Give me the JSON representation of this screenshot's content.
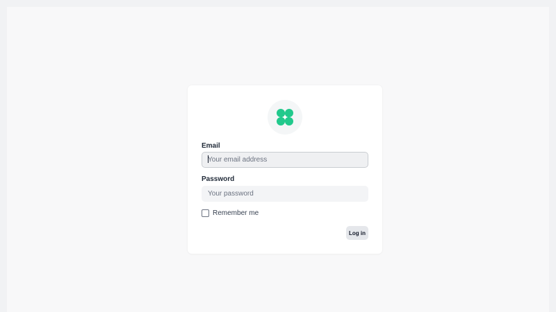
{
  "logo": {
    "name": "clover-logo-icon",
    "color": "#21c98c"
  },
  "form": {
    "email_label": "Email",
    "email_placeholder": "Your email address",
    "email_value": "",
    "password_label": "Password",
    "password_placeholder": "Your password",
    "password_value": "",
    "remember_label": "Remember me",
    "remember_checked": false,
    "login_label": "Log in"
  }
}
